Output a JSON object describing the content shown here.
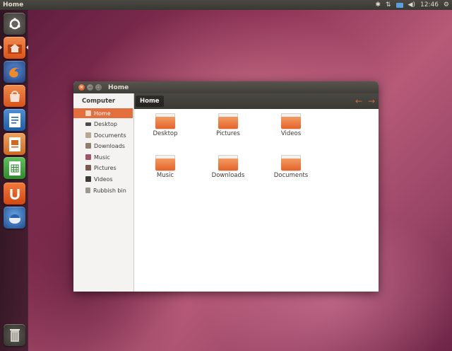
{
  "panel": {
    "app_title": "Home",
    "clock": "12:46",
    "indicators": [
      "bluetooth-icon",
      "network-icon",
      "mail-icon",
      "volume-icon",
      "gear-icon"
    ]
  },
  "launcher": {
    "items": [
      "dash-home-icon",
      "home-folder-icon",
      "firefox-icon",
      "software-center-icon",
      "libreoffice-writer-icon",
      "libreoffice-impress-icon",
      "libreoffice-calc-icon",
      "ubuntu-one-icon",
      "thunderbird-icon",
      "trash-icon"
    ],
    "colors": {
      "orange": "#dd4814",
      "launcher_bg": "#3a1c2c"
    }
  },
  "window": {
    "title": "Home",
    "sidebar": {
      "heading": "Computer",
      "items": [
        {
          "label": "Home",
          "icon": "home-icon",
          "active": true
        },
        {
          "label": "Desktop",
          "icon": "desktop-icon"
        },
        {
          "label": "Documents",
          "icon": "documents-icon"
        },
        {
          "label": "Downloads",
          "icon": "downloads-icon"
        },
        {
          "label": "Music",
          "icon": "music-icon"
        },
        {
          "label": "Pictures",
          "icon": "pictures-icon"
        },
        {
          "label": "Videos",
          "icon": "videos-icon"
        },
        {
          "label": "Rubbish bin",
          "icon": "rubbish-bin-icon"
        }
      ]
    },
    "location": {
      "crumb": "Home",
      "back": "←",
      "forward": "→"
    },
    "folders": [
      "Desktop",
      "Pictures",
      "Videos",
      "Music",
      "Downloads",
      "Documents"
    ],
    "accent": "#e46f3e"
  }
}
